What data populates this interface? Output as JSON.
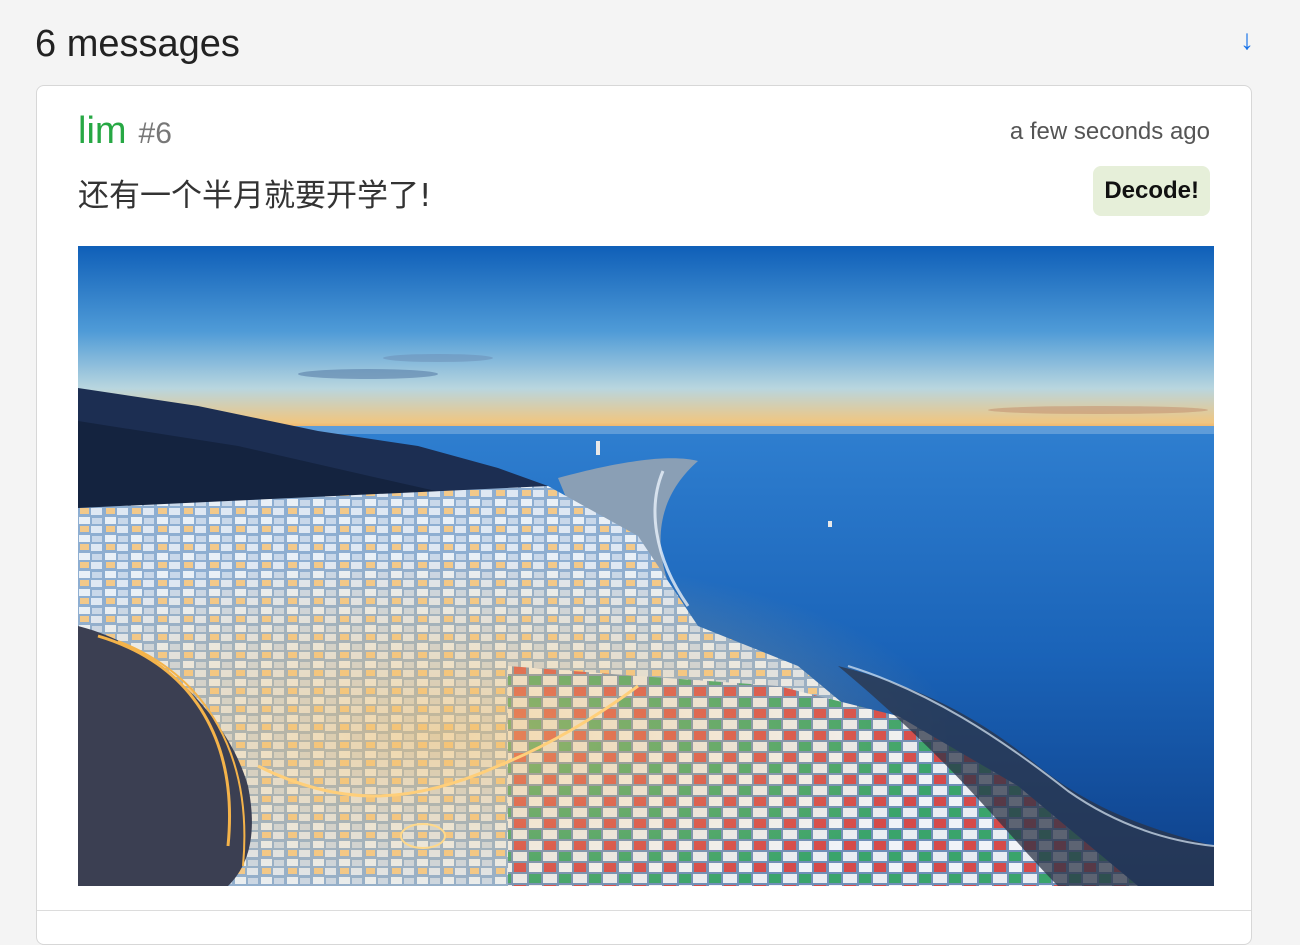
{
  "header": {
    "title": "6 messages",
    "scroll_down_glyph": "↓",
    "scroll_down_icon": "arrow-down-icon"
  },
  "message": {
    "author": "lim",
    "id_label": "#6",
    "time": "a few seconds ago",
    "text": "还有一个半月就要开学了!",
    "decode_label": "Decode!",
    "image_icon": "coastal-town-photo"
  },
  "colors": {
    "author": "#27a844",
    "accent_link": "#1a73e8",
    "decode_bg": "#e6efd9",
    "page_bg": "#f4f4f4"
  }
}
